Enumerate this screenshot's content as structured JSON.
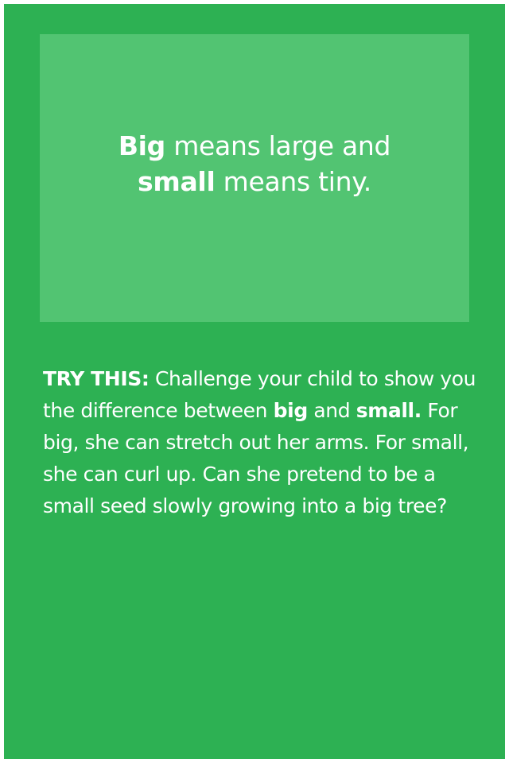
{
  "definition": {
    "word1": "Big",
    "text1": " means large and",
    "word2": "small",
    "text2": " means tiny."
  },
  "tip": {
    "label": "TRY THIS:",
    "text1": " Challenge your child to show you the difference between ",
    "word1": "big",
    "text2": " and ",
    "word2": "small.",
    "text3": " For big, she can stretch out her arms. For small, she can curl up. Can she pretend to be a small seed slowly growing into a big tree?"
  },
  "colors": {
    "background": "#2db153",
    "definition_box": "#52c472",
    "text": "#ffffff"
  }
}
